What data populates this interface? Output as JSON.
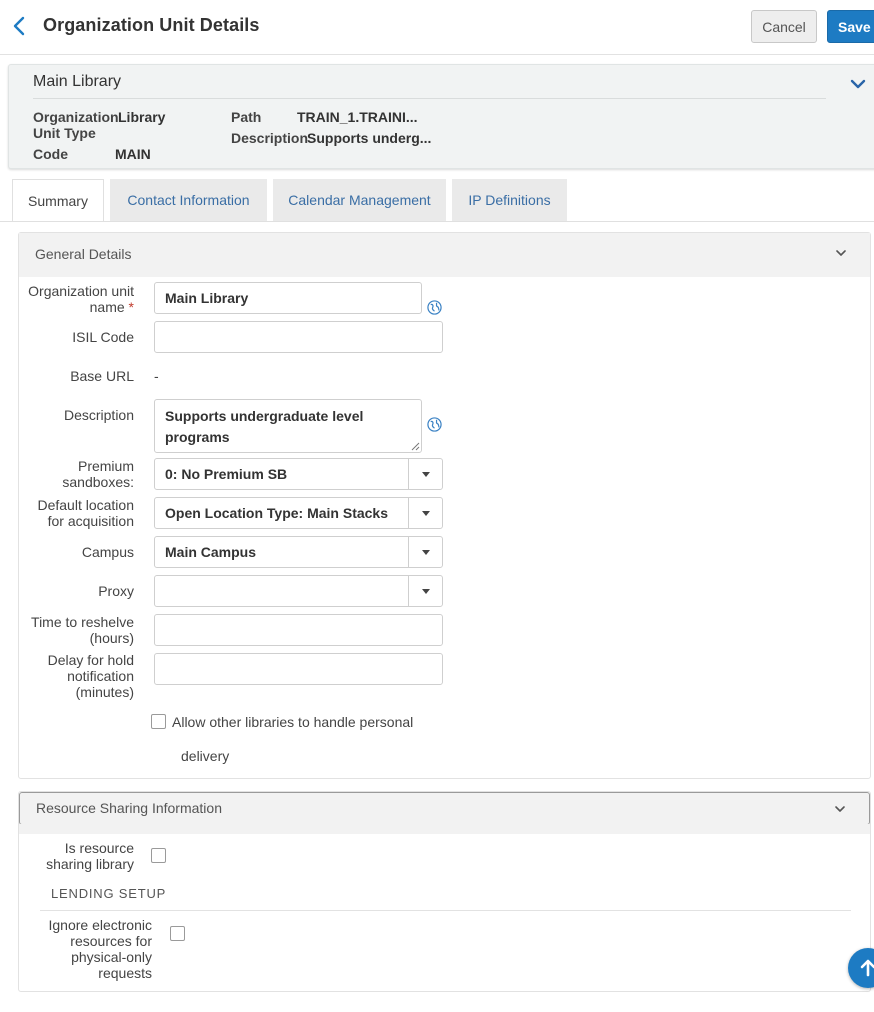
{
  "header": {
    "title": "Organization Unit Details",
    "cancel_label": "Cancel",
    "save_label": "Save"
  },
  "summary_card": {
    "title": "Main Library",
    "fields": {
      "org_unit_type_label_1": "Organization",
      "org_unit_type_label_2": "Unit Type",
      "org_unit_type_value": "Library",
      "code_label": "Code",
      "code_value": "MAIN",
      "path_label": "Path",
      "path_value": "TRAIN_1.TRAINI...",
      "description_label": "Description",
      "description_value": "Supports underg..."
    }
  },
  "tabs": [
    {
      "label": "Summary",
      "active": true
    },
    {
      "label": "Contact Information",
      "active": false
    },
    {
      "label": "Calendar Management",
      "active": false
    },
    {
      "label": "IP Definitions",
      "active": false
    }
  ],
  "general_details": {
    "title": "General Details",
    "org_unit_name_label_1": "Organization unit",
    "org_unit_name_label_2": "name",
    "org_unit_name_required": "*",
    "org_unit_name_value": "Main Library",
    "isil_code_label": "ISIL Code",
    "isil_code_value": "",
    "base_url_label": "Base URL",
    "base_url_value": "-",
    "description_label": "Description",
    "description_line_1": "Supports undergraduate level",
    "description_line_2": "programs",
    "premium_sandboxes_label_1": "Premium",
    "premium_sandboxes_label_2": "sandboxes:",
    "premium_sandboxes_value": "0: No Premium SB",
    "default_location_label_1": "Default location",
    "default_location_label_2": "for acquisition",
    "default_location_value": "Open Location Type: Main Stacks",
    "campus_label": "Campus",
    "campus_value": "Main Campus",
    "proxy_label": "Proxy",
    "proxy_value": "",
    "time_to_reshelve_label_1": "Time to reshelve",
    "time_to_reshelve_label_2": "(hours)",
    "time_to_reshelve_value": "",
    "delay_hold_label_1": "Delay for hold",
    "delay_hold_label_2": "notification",
    "delay_hold_label_3": "(minutes)",
    "delay_hold_value": "",
    "allow_other_libraries_label_1": "Allow other libraries to handle personal",
    "allow_other_libraries_label_2": "delivery",
    "allow_other_libraries_checked": false
  },
  "resource_sharing": {
    "title": "Resource Sharing Information",
    "is_rs_library_label_1": "Is resource",
    "is_rs_library_label_2": "sharing library",
    "is_rs_library_checked": false,
    "lending_setup_label": "LENDING SETUP",
    "ignore_electronic_label_1": "Ignore electronic",
    "ignore_electronic_label_2": "resources for",
    "ignore_electronic_label_3": "physical-only",
    "ignore_electronic_label_4": "requests",
    "ignore_electronic_checked": false
  },
  "colors": {
    "primary": "#1d7bc3",
    "link": "#3a6ea5",
    "required": "#c0392b",
    "globe": "#3b82c4"
  },
  "icons": {
    "back": "chevron-left-icon",
    "collapse": "chevron-down-icon",
    "translate": "globe-icon",
    "scroll_top": "arrow-up-icon"
  }
}
